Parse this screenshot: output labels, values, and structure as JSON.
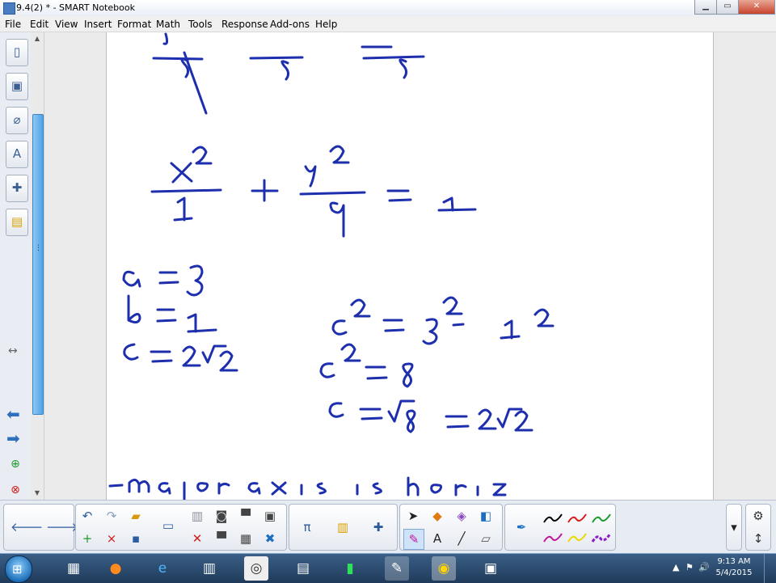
{
  "window": {
    "title": "9.4(2) * - SMART Notebook",
    "minimize_glyph": "▁",
    "maximize_glyph": "▭",
    "close_glyph": "✕"
  },
  "menu": [
    "File",
    "Edit",
    "View",
    "Insert",
    "Format",
    "Math",
    "Tools",
    "Response",
    "Add-ons",
    "Help"
  ],
  "side_tabs": [
    {
      "icon": "page-sorter-icon",
      "glyph": "▯"
    },
    {
      "icon": "gallery-icon",
      "glyph": "▣"
    },
    {
      "icon": "attachments-icon",
      "glyph": "⌀"
    },
    {
      "icon": "properties-icon",
      "glyph": "A"
    },
    {
      "icon": "add-ons-icon",
      "glyph": "✚"
    },
    {
      "icon": "response-icon",
      "glyph": "▤"
    }
  ],
  "side_controls": {
    "resize_glyph": "↔",
    "prev_glyph": "⬅",
    "next_glyph": "➡",
    "add_page_glyph": "⊕",
    "delete_page_glyph": "⊗"
  },
  "toolbar": {
    "back_glyph": "🡐",
    "forward_glyph": "🡒",
    "undo_glyph": "↶",
    "redo_glyph": "↷",
    "open_glyph": "▰",
    "add_page_glyph": "+",
    "delete_page_glyph": "×",
    "save_glyph": "▪",
    "display_glyph": "▭",
    "paste_glyph": "▥",
    "screen_capture_glyph": "◙",
    "screen_shade_glyph": "▀",
    "full_screen_glyph": "▣",
    "delete_glyph": "✕",
    "table_glyph": "▦",
    "close_glyph": "✖",
    "math_glyph": "π",
    "response_glyph": "▥",
    "addon_glyph": "✚",
    "select_glyph": "➤",
    "shapes_glyph": "◆",
    "eraser_glyph": "◈",
    "fill_glyph": "◧",
    "pens_glyph": "✎",
    "text_glyph": "A",
    "lines_glyph": "╱",
    "erase_glyph": "▱",
    "pen_tool_glyph": "✒",
    "more_glyph": "▾",
    "settings_glyph": "⚙",
    "move_glyph": "↕"
  },
  "pen_colors": [
    "#000000",
    "#d81b1b",
    "#1a9a2c",
    "#c4149c",
    "#e8d800",
    "#8b18c9"
  ],
  "taskbar": {
    "start_glyph": "⊞",
    "clock_time": "9:13 AM",
    "clock_date": "5/4/2015",
    "tray_up_glyph": "▲",
    "tray_flag_glyph": "⚑",
    "tray_volume_glyph": "🔊"
  }
}
